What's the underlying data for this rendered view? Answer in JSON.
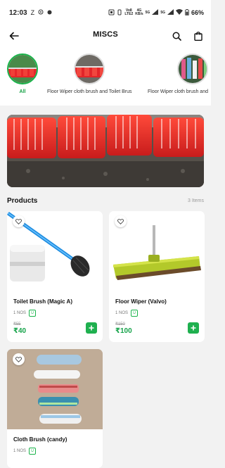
{
  "status_bar": {
    "time": "12:03",
    "carrier_z": "Z",
    "volte1": "Vo8",
    "volte1_sub": "LTE2",
    "lte2": "4G",
    "lte2_sub": "KB/s",
    "sig1": "5G",
    "sig2": "5G",
    "battery": "66%"
  },
  "header": {
    "title": "MISCS",
    "back_icon": "arrow-left-icon",
    "search_icon": "search-icon",
    "bag_icon": "shopping-bag-icon"
  },
  "categories": [
    {
      "label": "All",
      "active": true
    },
    {
      "label": "Floor Wiper cloth brush and Toilet Brus",
      "active": false
    },
    {
      "label": "Floor Wiper cloth brush and",
      "active": false
    }
  ],
  "products_section": {
    "title": "Products",
    "count": "3 Items"
  },
  "products": [
    {
      "name": "Toilet Brush (Magic A)",
      "unit": "1 NOS",
      "tag": "U",
      "mrp": "₹55",
      "price": "₹40"
    },
    {
      "name": "Floor Wiper (Valvo)",
      "unit": "1 NOS",
      "tag": "U",
      "mrp": "₹150",
      "price": "₹100"
    },
    {
      "name": "Cloth Brush (candy)",
      "unit": "1 NOS",
      "tag": "U"
    }
  ],
  "colors": {
    "accent": "#1fb04f",
    "price": "#16a34a",
    "active_ring": "#19b34a"
  }
}
